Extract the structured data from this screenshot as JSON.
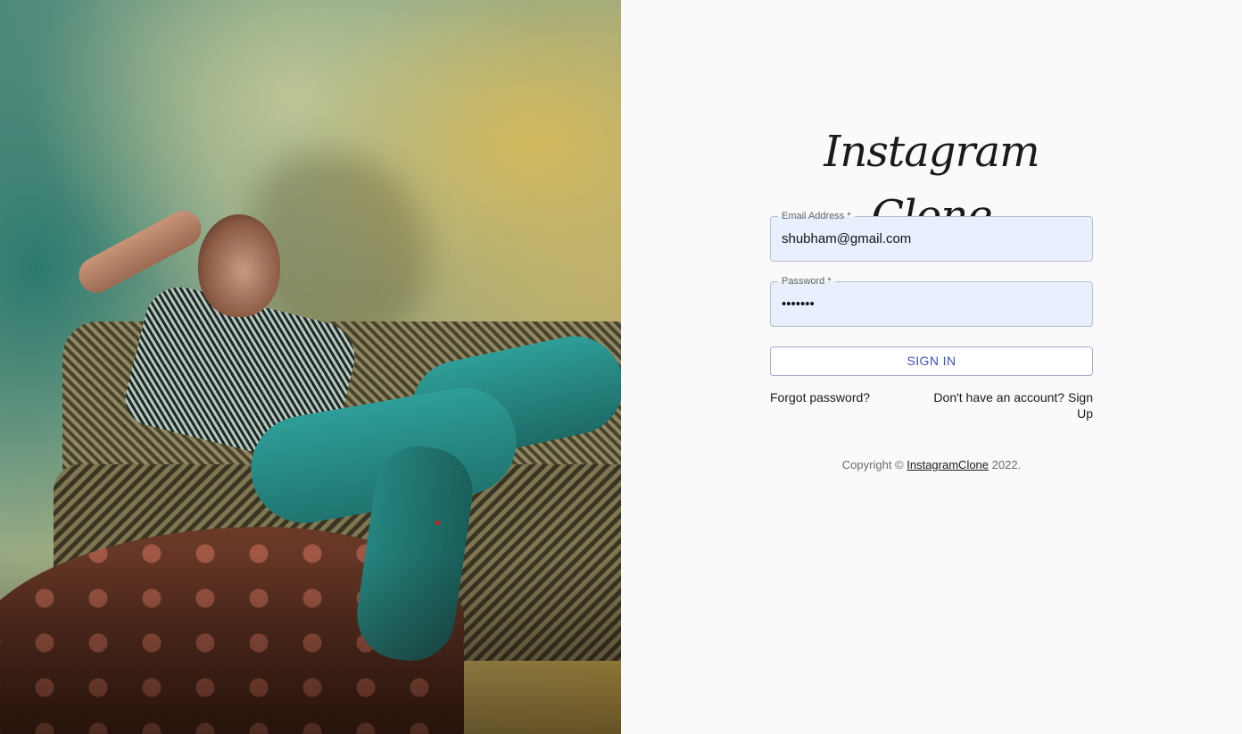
{
  "hero": {
    "image": "woman-on-sofa-photo"
  },
  "logo": {
    "text": "Instagram Clone"
  },
  "form": {
    "email": {
      "label": "Email Address *",
      "value": "shubham@gmail.com"
    },
    "password": {
      "label": "Password *",
      "value": "•••••••"
    },
    "submit_label": "SIGN IN",
    "forgot_password": "Forgot password?",
    "signup_prompt": "Don't have an account? Sign Up"
  },
  "footer": {
    "prefix": "Copyright © ",
    "link": "InstagramClone",
    "suffix": " 2022."
  },
  "colors": {
    "accent": "#3f51b5",
    "autofill_bg": "#e8f0fe",
    "panel_bg": "#fafafa"
  }
}
